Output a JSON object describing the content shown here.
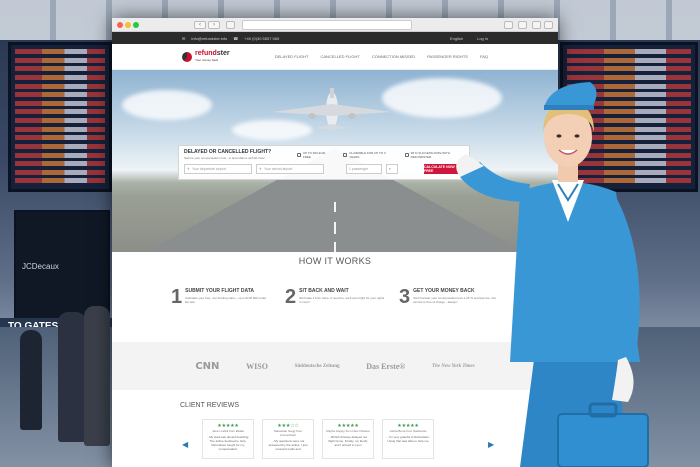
{
  "background": {
    "ad_brand": "JCDecaux",
    "gates_sign": "TO GATES"
  },
  "topbar": {
    "email": "info@refundster.info",
    "phone": "+49 (0)30 5557 565",
    "language": "English",
    "login": "Log in"
  },
  "header": {
    "logo_main": "refund",
    "logo_accent": "ster",
    "logo_tagline": "Your money back",
    "menu": [
      "DELAYED FLIGHT",
      "CANCELLED FLIGHT",
      "CONNECTION MISSED",
      "PASSENGER RIGHTS",
      "FAQ"
    ]
  },
  "search": {
    "title": "DELAYED OR CANCELLED FLIGHT?",
    "subtitle": "Secure your compensation now - in accordance with EU law!",
    "badges": [
      "UP TO 600 EUR. FREE",
      "CLAIMABLE FOR UP TO 3 YEARS",
      "98 % SUCCESS RATE WITH REFUNDSTER"
    ],
    "departure_placeholder": "Your departure airport",
    "arrival_placeholder": "Your arrival airport",
    "passengers": "1 passenger",
    "cta": "CALCULATE NOW FREE"
  },
  "how": {
    "title": "HOW IT WORKS",
    "steps": [
      {
        "num": "1",
        "title": "SUBMIT YOUR FLIGHT DATA",
        "text": "Calculate your free, non-binding claim - up to EUR 600 under EU law."
      },
      {
        "num": "2",
        "title": "SIT BACK AND WAIT",
        "text": "We'll take it from there. If need be, we'll even fight for your rights in court!"
      },
      {
        "num": "3",
        "title": "GET YOUR MONEY BACK",
        "text": "We'll transfer your compensation less a 25 % success fee. Our service is free of charge - always!"
      }
    ]
  },
  "press": [
    "CNN",
    "WISO",
    "Süddeutsche Zeitung",
    "Das Erste®",
    "The New York Times"
  ],
  "reviews": {
    "title": "CLIENT REVIEWS",
    "cards": [
      {
        "stars": "★★★★★",
        "name": "Jane Lindell from Elidas",
        "text": "...My lead was denied boarding. The airline declined to help. Refundster fought for my compensation"
      },
      {
        "stars": "★★★☆☆",
        "name": "Sebastian Gegg from Ammerbach",
        "text": "...My questions were not answered by the airline. I just received mails and"
      },
      {
        "stars": "★★★★★",
        "name": "Maybe Happy from New Orleans",
        "text": "...British Airways delayed our flight home. Finally, my family and I arrived in Lyon"
      },
      {
        "stars": "★★★★★",
        "name": "Gloria Bona from Natiscotte",
        "text": "...I'm very grateful to Refundster. Using that was able to help me"
      }
    ]
  }
}
